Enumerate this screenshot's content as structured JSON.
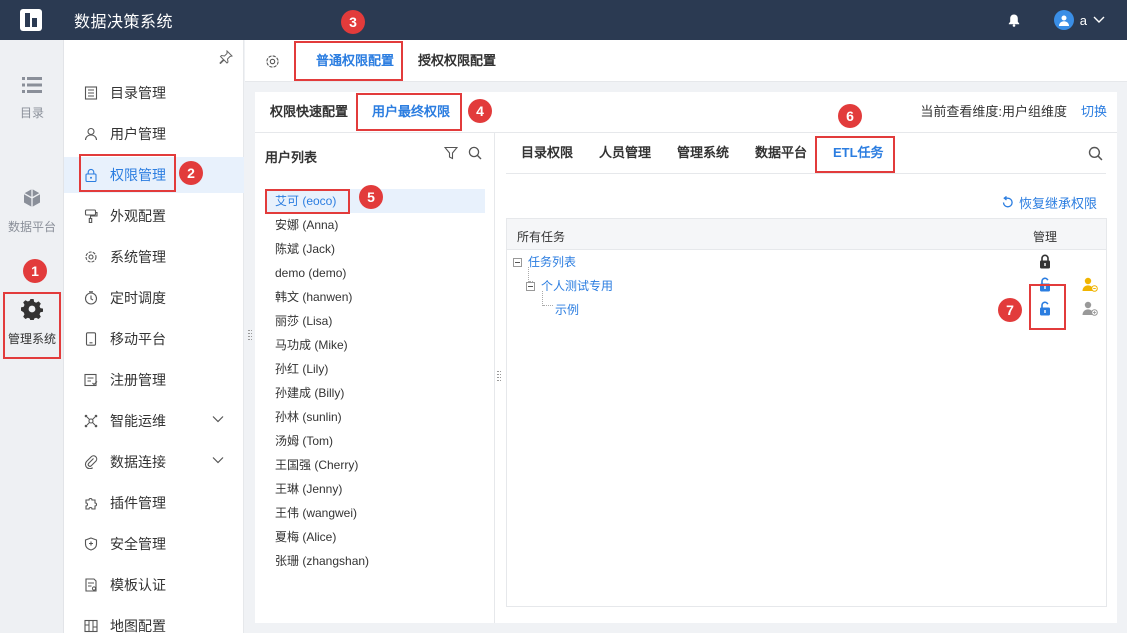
{
  "app": {
    "title": "数据决策系统",
    "user_name": "a"
  },
  "rail": [
    {
      "label": "目录",
      "icon": "list-icon"
    },
    {
      "label": "数据平台",
      "icon": "cube-icon"
    },
    {
      "label": "管理系统",
      "icon": "gear-icon"
    }
  ],
  "subnav": [
    {
      "label": "目录管理",
      "icon": "catalog-icon"
    },
    {
      "label": "用户管理",
      "icon": "user-icon"
    },
    {
      "label": "权限管理",
      "icon": "lock-icon"
    },
    {
      "label": "外观配置",
      "icon": "brush-icon"
    },
    {
      "label": "系统管理",
      "icon": "gear-icon"
    },
    {
      "label": "定时调度",
      "icon": "clock-icon"
    },
    {
      "label": "移动平台",
      "icon": "mobile-icon"
    },
    {
      "label": "注册管理",
      "icon": "register-icon"
    },
    {
      "label": "智能运维",
      "icon": "network-icon"
    },
    {
      "label": "数据连接",
      "icon": "link-icon"
    },
    {
      "label": "插件管理",
      "icon": "puzzle-icon"
    },
    {
      "label": "安全管理",
      "icon": "shield-icon"
    },
    {
      "label": "模板认证",
      "icon": "template-icon"
    },
    {
      "label": "地图配置",
      "icon": "map-icon"
    }
  ],
  "top_tabs": [
    "普通权限配置",
    "授权权限配置"
  ],
  "sub_tabs": [
    "权限快速配置",
    "用户最终权限"
  ],
  "dimension_text": "当前查看维度:用户组维度",
  "switch_label": "切换",
  "user_panel_title": "用户列表",
  "users": [
    "艾可 (eoco)",
    "安娜 (Anna)",
    "陈斌 (Jack)",
    "demo (demo)",
    "韩文 (hanwen)",
    "丽莎 (Lisa)",
    "马功成 (Mike)",
    "孙红 (Lily)",
    "孙建成 (Billy)",
    "孙林 (sunlin)",
    "汤姆 (Tom)",
    "王国强 (Cherry)",
    "王琳 (Jenny)",
    "王伟 (wangwei)",
    "夏梅 (Alice)",
    "张珊 (zhangshan)"
  ],
  "right_tabs": [
    "目录权限",
    "人员管理",
    "管理系统",
    "数据平台",
    "ETL任务"
  ],
  "restore_label": "恢复继承权限",
  "table": {
    "col_all": "所有任务",
    "col_manage": "管理"
  },
  "tree": [
    "任务列表",
    "个人测试专用",
    "示例"
  ],
  "badges": [
    "1",
    "2",
    "3",
    "4",
    "5",
    "6",
    "7"
  ],
  "colors": {
    "accent": "#2b7de0",
    "topbar": "#2b3a52",
    "annotation": "#e23b3b"
  }
}
